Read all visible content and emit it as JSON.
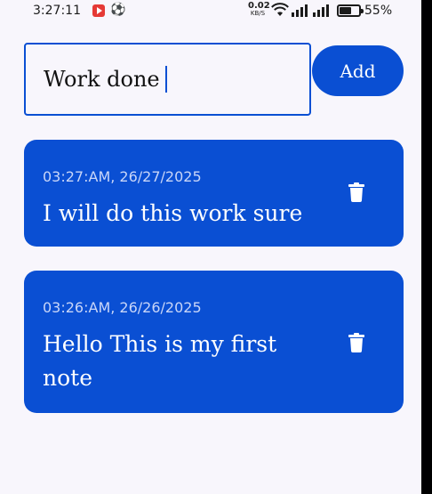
{
  "status_bar": {
    "time": "3:27:11",
    "net_speed_value": "0.02",
    "net_speed_unit": "KB/S",
    "battery_percent": "55%"
  },
  "input": {
    "value": "Work done",
    "accent_color": "#0a4fd3"
  },
  "add_button": {
    "label": "Add"
  },
  "notes": [
    {
      "timestamp": "03:27:AM, 26/27/2025",
      "text": "I will do this work sure"
    },
    {
      "timestamp": "03:26:AM, 26/26/2025",
      "text": "Hello This is my first note"
    }
  ],
  "icons": {
    "delete": "trash-icon"
  }
}
